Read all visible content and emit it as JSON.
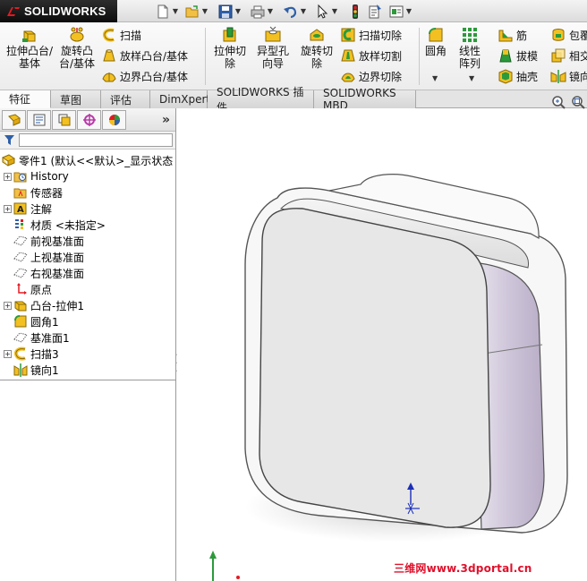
{
  "app": {
    "brand_prefix": "3S",
    "brand_name": "SOLIDWORKS"
  },
  "commands": {
    "extrude_boss": "拉伸凸台/基体",
    "revolve_boss": "旋转凸台/基体",
    "sweep": "扫描",
    "loft_boss": "放样凸台/基体",
    "boundary_boss": "边界凸台/基体",
    "extrude_cut": "拉伸切除",
    "hole_wizard": "异型孔向导",
    "revolve_cut": "旋转切除",
    "swept_cut": "扫描切除",
    "lofted_cut": "放样切割",
    "boundary_cut": "边界切除",
    "fillet": "圆角",
    "linear_pattern": "线性阵列",
    "rib": "筋",
    "draft": "拔模",
    "shell": "抽壳",
    "wrap": "包覆",
    "intersect": "相交",
    "mirror": "镜向"
  },
  "tabs": [
    {
      "label": "特征",
      "active": true
    },
    {
      "label": "草图",
      "active": false
    },
    {
      "label": "评估",
      "active": false
    },
    {
      "label": "DimXpert",
      "active": false
    },
    {
      "label": "SOLIDWORKS 插件",
      "active": false
    },
    {
      "label": "SOLIDWORKS MBD",
      "active": false
    }
  ],
  "feature_tree": {
    "more_symbol": "»",
    "root": "零件1 (默认<<默认>_显示状态",
    "items": [
      {
        "label": "History",
        "icon": "history-folder-icon",
        "expandable": true
      },
      {
        "label": "传感器",
        "icon": "sensor-icon",
        "expandable": false
      },
      {
        "label": "注解",
        "icon": "annotation-icon",
        "expandable": true
      },
      {
        "label": "材质 <未指定>",
        "icon": "material-icon",
        "expandable": false
      },
      {
        "label": "前视基准面",
        "icon": "plane-icon",
        "expandable": false
      },
      {
        "label": "上视基准面",
        "icon": "plane-icon",
        "expandable": false
      },
      {
        "label": "右视基准面",
        "icon": "plane-icon",
        "expandable": false
      },
      {
        "label": "原点",
        "icon": "origin-icon",
        "expandable": false
      },
      {
        "label": "凸台-拉伸1",
        "icon": "extrude-icon",
        "expandable": true
      },
      {
        "label": "圆角1",
        "icon": "fillet-icon",
        "expandable": false
      },
      {
        "label": "基准面1",
        "icon": "plane-icon",
        "expandable": false
      },
      {
        "label": "扫描3",
        "icon": "sweep-icon",
        "expandable": true
      },
      {
        "label": "镜向1",
        "icon": "mirror-icon",
        "expandable": false
      }
    ]
  },
  "watermark": "三维网www.3dportal.cn",
  "colors": {
    "accent_yellow": "#f3c021",
    "accent_green": "#2c9a3b",
    "model_face": "#e6e6e6",
    "model_side": "#c6bcd3",
    "watermark_red": "#e0102b"
  }
}
